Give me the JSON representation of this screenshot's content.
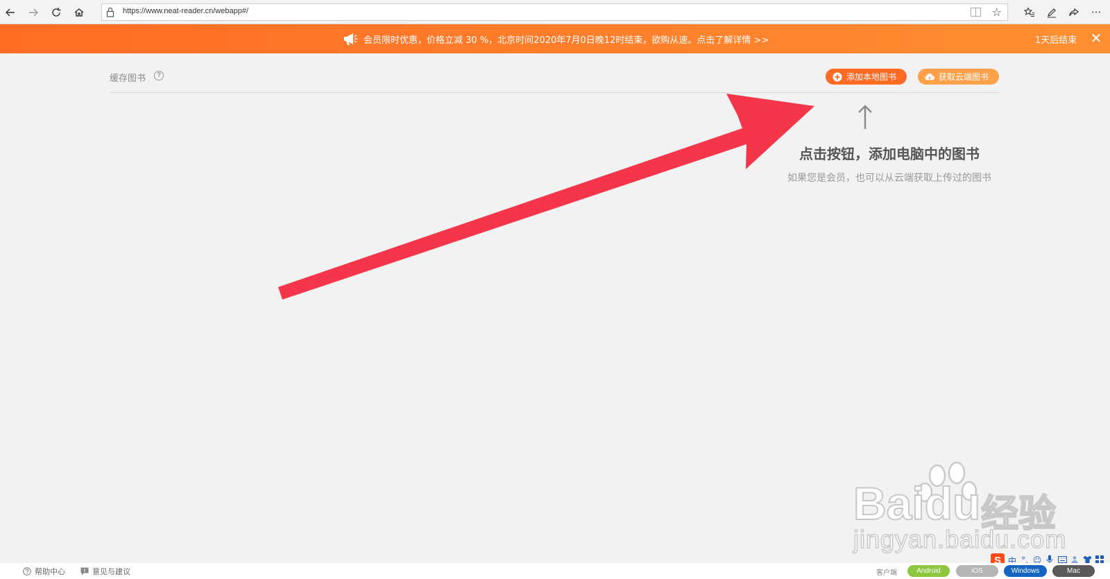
{
  "browser": {
    "url": "https://www.neat-reader.cn/webapp#/"
  },
  "promo": {
    "text": "会员限时优惠，价格立减 30 %，北京时间2020年7月0日晚12时结束，欲购从速。点击了解详情 >>",
    "countdown": "1天后结束",
    "close": "✕"
  },
  "library": {
    "title": "缓存图书",
    "help": "?",
    "add_local_label": "添加本地图书",
    "cloud_label": "获取云端图书"
  },
  "empty_state": {
    "title": "点击按钮，添加电脑中的图书",
    "subtitle": "如果您是会员，也可以从云端获取上传过的图书"
  },
  "watermark": {
    "brand": "Baidu",
    "brand_cn": "经验",
    "domain": "jingyan.baidu.com"
  },
  "ime": {
    "logo": "S",
    "mode": "中",
    "punct": "°,"
  },
  "footer": {
    "help_center": "帮助中心",
    "feedback": "意见与建议",
    "client_label": "客户端",
    "platforms": [
      {
        "label": "Android",
        "color": "#8dc63f"
      },
      {
        "label": "iOS",
        "color": "#b5b5b5"
      },
      {
        "label": "Windows",
        "color": "#1565c0"
      },
      {
        "label": "Mac",
        "color": "#5a5a5a"
      }
    ]
  },
  "colors": {
    "banner": "#ff7d2b",
    "add_button": "#ff6a25",
    "cloud_button": "#ffa04a",
    "annotation_arrow": "#f5364a"
  }
}
